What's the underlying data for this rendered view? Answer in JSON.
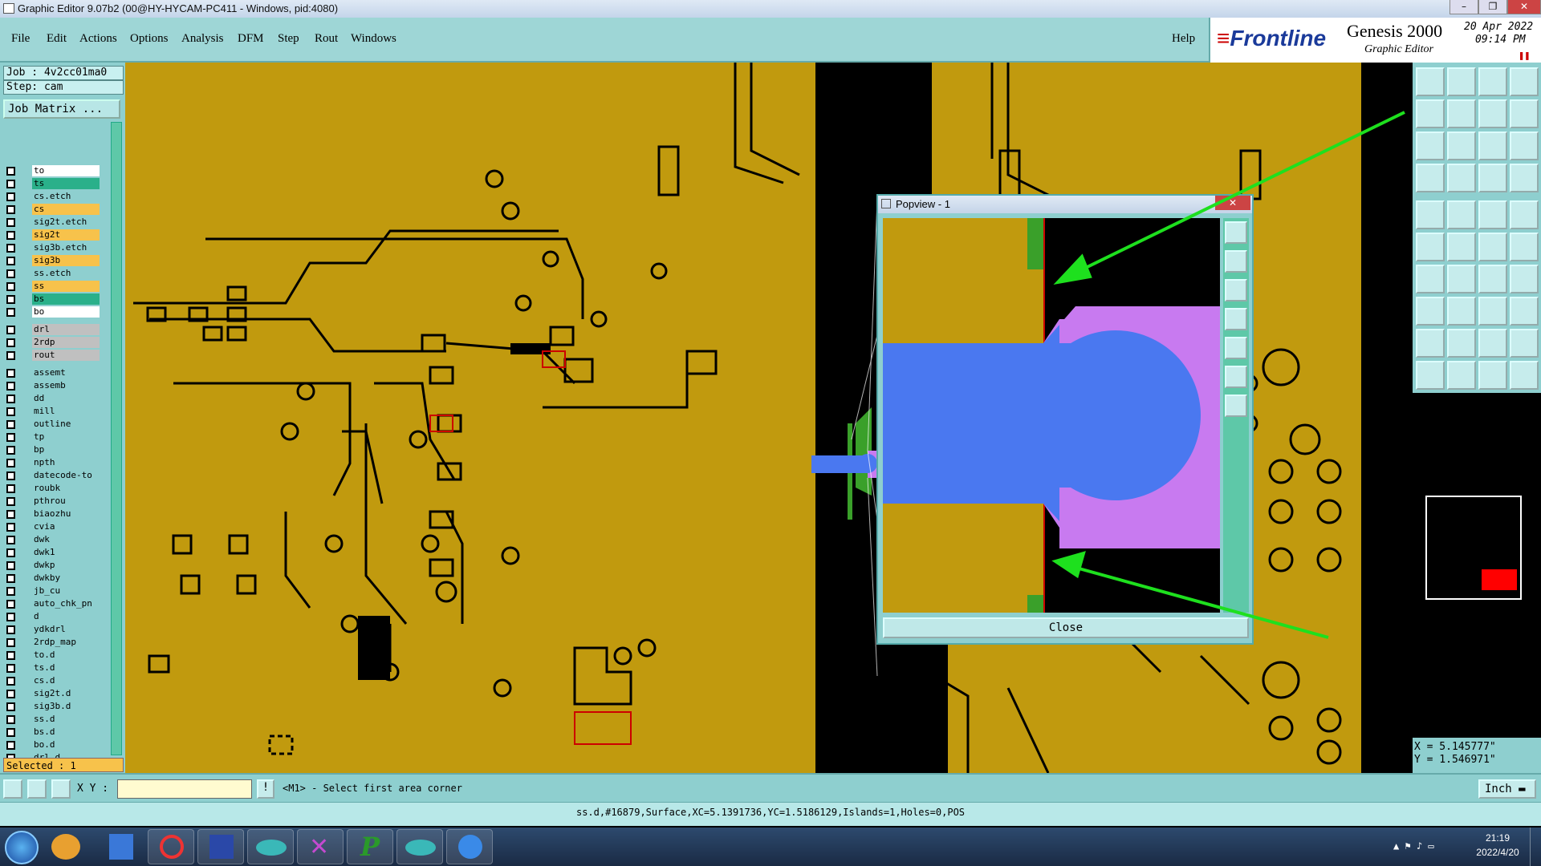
{
  "window": {
    "title": "Graphic Editor 9.07b2 (00@HY-HYCAM-PC411 - Windows, pid:4080)"
  },
  "menu": {
    "items": [
      "File",
      "Edit",
      "Actions",
      "Options",
      "Analysis",
      "DFM",
      "Step",
      "Rout",
      "Windows"
    ],
    "help": "Help"
  },
  "brand": {
    "logo": "Frontline",
    "product": "Genesis 2000",
    "subtitle": "Graphic Editor",
    "date": "20 Apr 2022",
    "time": "09:14 PM"
  },
  "left": {
    "job": "Job : 4v2cc01ma0",
    "step": "Step: cam",
    "job_matrix": "Job Matrix ...",
    "layers": [
      {
        "name": "to",
        "color": "#ffffff"
      },
      {
        "name": "ts",
        "color": "#2ab08a"
      },
      {
        "name": "cs.etch",
        "color": "#8ecfcf"
      },
      {
        "name": "cs",
        "color": "#f7c24b"
      },
      {
        "name": "sig2t.etch",
        "color": "#8ecfcf"
      },
      {
        "name": "sig2t",
        "color": "#f7c24b"
      },
      {
        "name": "sig3b.etch",
        "color": "#8ecfcf"
      },
      {
        "name": "sig3b",
        "color": "#f7c24b"
      },
      {
        "name": "ss.etch",
        "color": "#8ecfcf"
      },
      {
        "name": "ss",
        "color": "#f7c24b"
      },
      {
        "name": "bs",
        "color": "#2ab08a"
      },
      {
        "name": "bo",
        "color": "#ffffff"
      },
      {
        "name": "drl",
        "color": "#c0c0c0"
      },
      {
        "name": "2rdp",
        "color": "#c0c0c0"
      },
      {
        "name": "rout",
        "color": "#c0c0c0"
      },
      {
        "name": "assemt",
        "color": "#8ecfcf"
      },
      {
        "name": "assemb",
        "color": "#8ecfcf"
      },
      {
        "name": "dd",
        "color": "#8ecfcf"
      },
      {
        "name": "mill",
        "color": "#8ecfcf"
      },
      {
        "name": "outline",
        "color": "#8ecfcf"
      },
      {
        "name": "tp",
        "color": "#8ecfcf"
      },
      {
        "name": "bp",
        "color": "#8ecfcf"
      },
      {
        "name": "npth",
        "color": "#8ecfcf"
      },
      {
        "name": "datecode-to",
        "color": "#8ecfcf"
      },
      {
        "name": "roubk",
        "color": "#8ecfcf"
      },
      {
        "name": "pthrou",
        "color": "#8ecfcf"
      },
      {
        "name": "biaozhu",
        "color": "#8ecfcf"
      },
      {
        "name": "cvia",
        "color": "#8ecfcf"
      },
      {
        "name": "dwk",
        "color": "#8ecfcf"
      },
      {
        "name": "dwk1",
        "color": "#8ecfcf"
      },
      {
        "name": "dwkp",
        "color": "#8ecfcf"
      },
      {
        "name": "dwkby",
        "color": "#8ecfcf"
      },
      {
        "name": "jb_cu",
        "color": "#8ecfcf"
      },
      {
        "name": "auto_chk_pn",
        "color": "#8ecfcf"
      },
      {
        "name": "d",
        "color": "#8ecfcf"
      },
      {
        "name": "ydkdrl",
        "color": "#8ecfcf"
      },
      {
        "name": "2rdp_map",
        "color": "#8ecfcf"
      },
      {
        "name": "to.d",
        "color": "#8ecfcf"
      },
      {
        "name": "ts.d",
        "color": "#8ecfcf"
      },
      {
        "name": "cs.d",
        "color": "#8ecfcf"
      },
      {
        "name": "sig2t.d",
        "color": "#8ecfcf"
      },
      {
        "name": "sig3b.d",
        "color": "#8ecfcf"
      },
      {
        "name": "ss.d",
        "color": "#8ecfcf"
      },
      {
        "name": "bs.d",
        "color": "#8ecfcf"
      },
      {
        "name": "bo.d",
        "color": "#8ecfcf"
      },
      {
        "name": "drl.d",
        "color": "#8ecfcf"
      }
    ],
    "selected": "Selected : 1"
  },
  "popview": {
    "title": "Popview - 1",
    "close": "Close"
  },
  "coords": {
    "x": "X = 5.145777\"",
    "y": "Y = 1.546971\""
  },
  "status": {
    "xy_label": "X Y :",
    "prompt": "<M1> - Select first area corner",
    "units": "Inch"
  },
  "command": {
    "text": "ss.d,#16879,Surface,XC=5.1391736,YC=1.5186129,Islands=1,Holes=0,POS"
  },
  "clock": {
    "time": "21:19",
    "date": "2022/4/20"
  }
}
